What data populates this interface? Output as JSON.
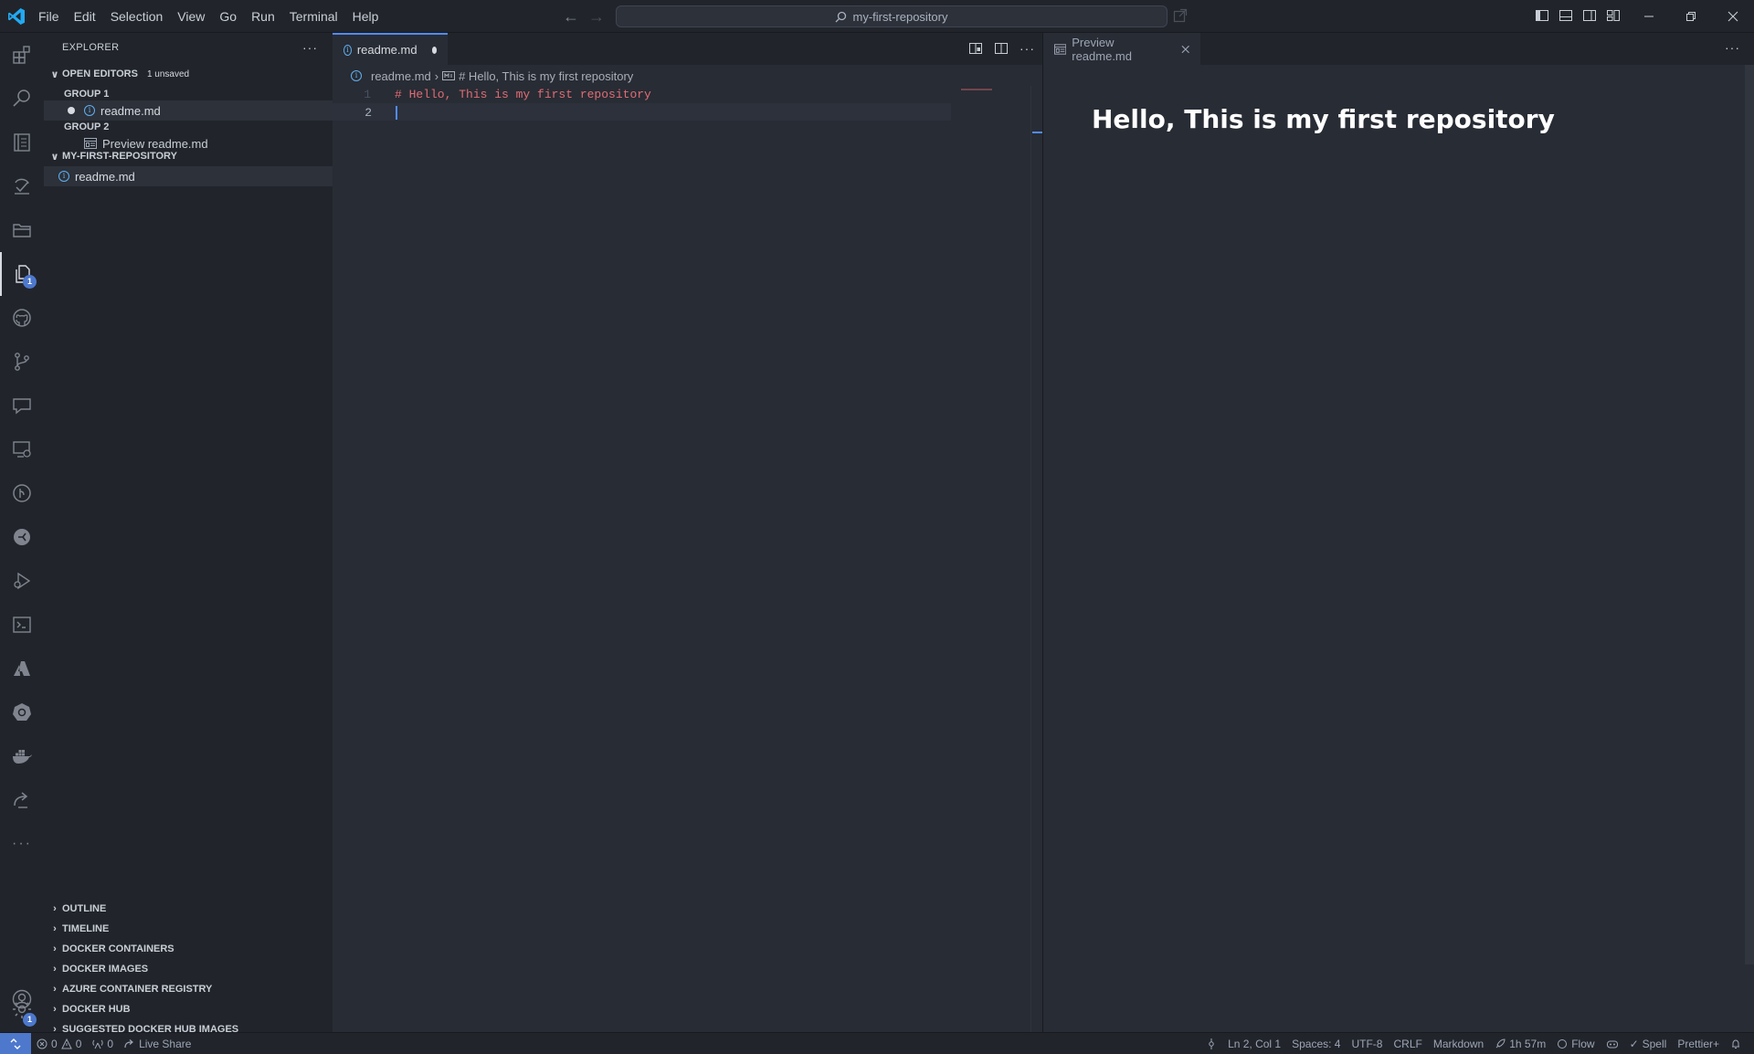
{
  "titlebar": {
    "menu": [
      "File",
      "Edit",
      "Selection",
      "View",
      "Go",
      "Run",
      "Terminal",
      "Help"
    ],
    "search_text": "my-first-repository"
  },
  "explorer": {
    "title": "EXPLORER",
    "open_editors": {
      "label": "OPEN EDITORS",
      "badge": "1 unsaved",
      "group1_label": "GROUP 1",
      "group1_file": "readme.md",
      "group2_label": "GROUP 2",
      "group2_file": "Preview readme.md"
    },
    "repo": {
      "label": "MY-FIRST-REPOSITORY",
      "file": "readme.md"
    },
    "sections": [
      "OUTLINE",
      "TIMELINE",
      "DOCKER CONTAINERS",
      "DOCKER IMAGES",
      "AZURE CONTAINER REGISTRY",
      "DOCKER HUB",
      "SUGGESTED DOCKER HUB IMAGES"
    ]
  },
  "editor": {
    "tab_label": "readme.md",
    "breadcrumb_file": "readme.md",
    "breadcrumb_symbol": "# Hello, This is my first repository",
    "lines": [
      {
        "number": "1",
        "text": "# Hello, This is my first repository"
      },
      {
        "number": "2",
        "text": ""
      }
    ]
  },
  "preview": {
    "tab_label": "Preview readme.md",
    "heading": "Hello, This is my first repository"
  },
  "activity_badges": {
    "explorer": "1",
    "settings": "1"
  },
  "statusbar": {
    "errors": "0",
    "warnings": "0",
    "ports": "0",
    "live_share": "Live Share",
    "position": "Ln 2, Col 1",
    "spaces": "Spaces: 4",
    "encoding": "UTF-8",
    "eol": "CRLF",
    "language": "Markdown",
    "time": "1h 57m",
    "flow": "Flow",
    "spell": "Spell",
    "prettier": "Prettier+"
  },
  "colors": {
    "accent": "#528bff",
    "heading_text": "#e06c75",
    "remote_button": "#4d78cc"
  }
}
